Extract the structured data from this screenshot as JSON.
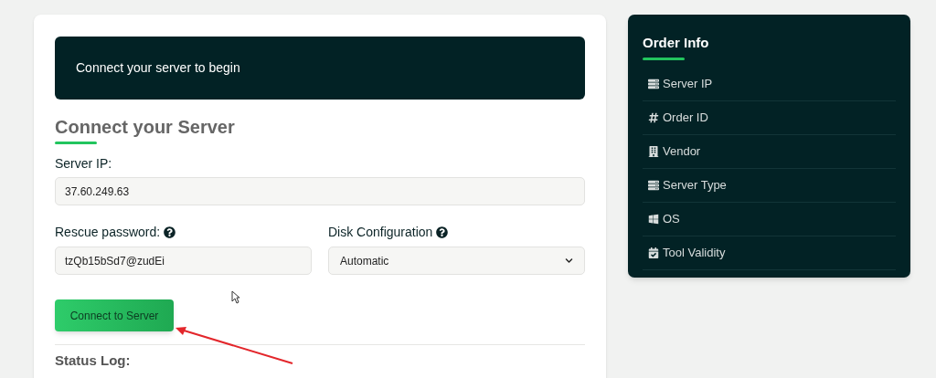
{
  "banner": {
    "text": "Connect your server to begin"
  },
  "form": {
    "title": "Connect your Server",
    "server_ip": {
      "label": "Server IP:",
      "value": "37.60.249.63"
    },
    "rescue_password": {
      "label": "Rescue password:",
      "value": "tzQb15bSd7@zudEi"
    },
    "disk_configuration": {
      "label": "Disk Configuration",
      "value": "Automatic"
    },
    "button": "Connect to Server",
    "status_log": "Status Log:"
  },
  "order_info": {
    "title": "Order Info",
    "items": [
      {
        "label": "Server IP"
      },
      {
        "label": "Order ID"
      },
      {
        "label": "Vendor"
      },
      {
        "label": "Server Type"
      },
      {
        "label": "OS"
      },
      {
        "label": "Tool Validity"
      }
    ]
  }
}
